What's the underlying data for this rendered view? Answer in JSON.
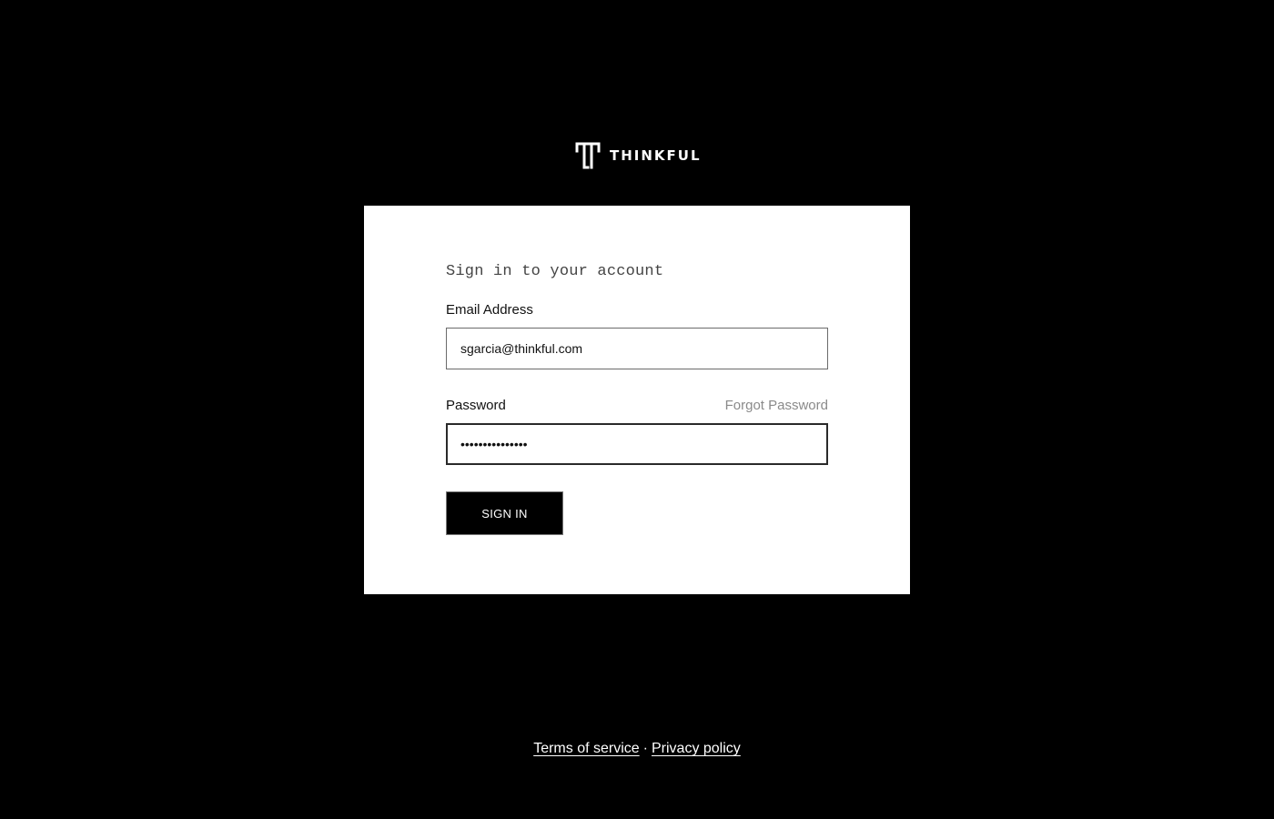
{
  "brand": {
    "name": "THINKFUL",
    "logo_icon": "thinkful-t-icon"
  },
  "login": {
    "heading": "Sign in to your account",
    "email_label": "Email Address",
    "email_value": "sgarcia@thinkful.com",
    "password_label": "Password",
    "password_value": "•••••••••••••••",
    "forgot_password": "Forgot Password",
    "submit_label": "SIGN IN"
  },
  "footer": {
    "terms": "Terms of service",
    "separator": "·",
    "privacy": "Privacy policy"
  },
  "colors": {
    "background": "#000000",
    "card": "#ffffff",
    "button": "#000000",
    "muted_link": "#8a8a8a"
  }
}
